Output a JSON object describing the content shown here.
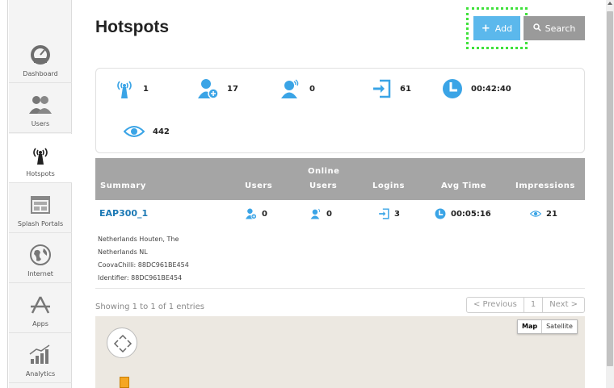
{
  "page": {
    "title": "Hotspots"
  },
  "toolbar": {
    "add_label": "Add",
    "search_label": "Search"
  },
  "sidebar": {
    "items": [
      {
        "label": "Dashboard",
        "icon": "speedometer-icon"
      },
      {
        "label": "Users",
        "icon": "users-icon"
      },
      {
        "label": "Hotspots",
        "icon": "wifi-tower-icon",
        "active": true
      },
      {
        "label": "Splash Portals",
        "icon": "window-icon"
      },
      {
        "label": "Internet",
        "icon": "globe-icon"
      },
      {
        "label": "Apps",
        "icon": "apps-icon"
      },
      {
        "label": "Analytics",
        "icon": "chart-icon"
      }
    ]
  },
  "stats": {
    "hotspots": "1",
    "new_users": "17",
    "online_users": "0",
    "logins": "61",
    "avg_time": "00:42:40",
    "impressions": "442"
  },
  "table": {
    "headers": {
      "summary": "Summary",
      "users": "Users",
      "online_line1": "Online",
      "online_line2": "Users",
      "logins": "Logins",
      "avg_time": "Avg Time",
      "impressions": "Impressions"
    },
    "rows": [
      {
        "name": "EAP300_1",
        "users": "0",
        "online": "0",
        "logins": "3",
        "avg_time": "00:05:16",
        "impressions": "21",
        "details": [
          "Netherlands Houten, The",
          "Netherlands NL",
          "CoovaChilli: 88DC961BE454",
          "Identifier: 88DC961BE454"
        ]
      }
    ]
  },
  "pagination": {
    "info": "Showing 1 to 1 of 1 entries",
    "previous": "< Previous",
    "page": "1",
    "next": "Next >"
  },
  "map": {
    "map_label": "Map",
    "satellite_label": "Satellite"
  },
  "colors": {
    "accent": "#5bb8ec",
    "link": "#1c79b5",
    "header_bg": "#a5a5a5",
    "highlight": "#3ee13a"
  }
}
